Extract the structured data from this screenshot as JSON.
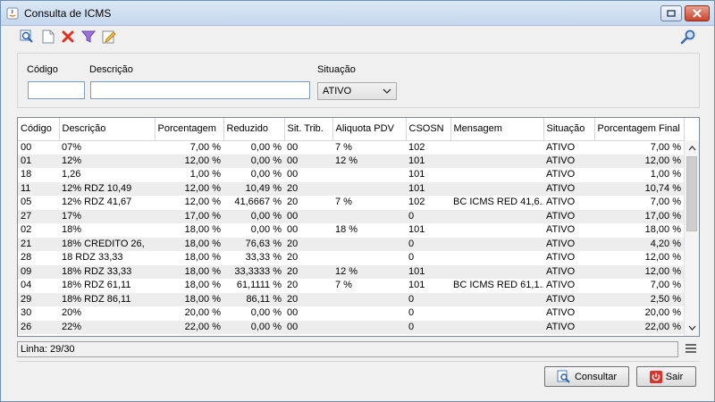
{
  "window": {
    "title": "Consulta de ICMS"
  },
  "toolbar": {
    "icons": [
      "zoom-search-icon",
      "new-document-icon",
      "delete-icon",
      "filter-icon",
      "edit-icon"
    ],
    "search_icon": "magnifier-icon"
  },
  "filters": {
    "codigo_label": "Código",
    "codigo_value": "",
    "descricao_label": "Descrição",
    "descricao_value": "",
    "situacao_label": "Situação",
    "situacao_value": "ATIVO"
  },
  "table": {
    "columns": [
      "Código",
      "Descrição",
      "Porcentagem",
      "Reduzido",
      "Sit. Trib.",
      "Aliquota PDV",
      "CSOSN",
      "Mensagem",
      "Situação",
      "Porcentagem Final"
    ],
    "rows": [
      [
        "00",
        "07%",
        "7,00 %",
        "0,00 %",
        "00",
        "7 %",
        "102",
        "",
        "ATIVO",
        "7,00 %"
      ],
      [
        "01",
        "12%",
        "12,00 %",
        "0,00 %",
        "00",
        "12 %",
        "101",
        "",
        "ATIVO",
        "12,00 %"
      ],
      [
        "18",
        "1,26",
        "1,00 %",
        "0,00 %",
        "00",
        "",
        "101",
        "",
        "ATIVO",
        "1,00 %"
      ],
      [
        "11",
        "12%  RDZ 10,49",
        "12,00 %",
        "10,49 %",
        "20",
        "",
        "101",
        "",
        "ATIVO",
        "10,74 %"
      ],
      [
        "05",
        "12% RDZ 41,67",
        "12,00 %",
        "41,6667 %",
        "20",
        "7 %",
        "102",
        "BC ICMS RED 41,6...",
        "ATIVO",
        "7,00 %"
      ],
      [
        "27",
        "17%",
        "17,00 %",
        "0,00 %",
        "00",
        "",
        "0",
        "",
        "ATIVO",
        "17,00 %"
      ],
      [
        "02",
        "18%",
        "18,00 %",
        "0,00 %",
        "00",
        "18 %",
        "101",
        "",
        "ATIVO",
        "18,00 %"
      ],
      [
        "21",
        "18% CREDITO 26,",
        "18,00 %",
        "76,63 %",
        "20",
        "",
        "0",
        "",
        "ATIVO",
        "4,20 %"
      ],
      [
        "28",
        "18 RDZ 33,33",
        "18,00 %",
        "33,33 %",
        "20",
        "",
        "0",
        "",
        "ATIVO",
        "12,00 %"
      ],
      [
        "09",
        "18% RDZ 33,33",
        "18,00 %",
        "33,3333 %",
        "20",
        "12 %",
        "101",
        "",
        "ATIVO",
        "12,00 %"
      ],
      [
        "04",
        "18% RDZ 61,11",
        "18,00 %",
        "61,1111 %",
        "20",
        "7 %",
        "101",
        "BC ICMS RED 61,1...",
        "ATIVO",
        "7,00 %"
      ],
      [
        "29",
        "18% RDZ 86,11",
        "18,00 %",
        "86,11 %",
        "20",
        "",
        "0",
        "",
        "ATIVO",
        "2,50 %"
      ],
      [
        "30",
        "20%",
        "20,00 %",
        "0,00 %",
        "00",
        "",
        "0",
        "",
        "ATIVO",
        "20,00 %"
      ],
      [
        "26",
        "22%",
        "22,00 %",
        "0,00 %",
        "00",
        "",
        "0",
        "",
        "ATIVO",
        "22,00 %"
      ]
    ]
  },
  "status": {
    "linha": "Linha: 29/30"
  },
  "buttons": {
    "consultar": "Consultar",
    "sair": "Sair"
  },
  "colors": {
    "delete": "#e0301e",
    "filter": "#8b5fc7",
    "sair_icon": "#d9342b"
  }
}
